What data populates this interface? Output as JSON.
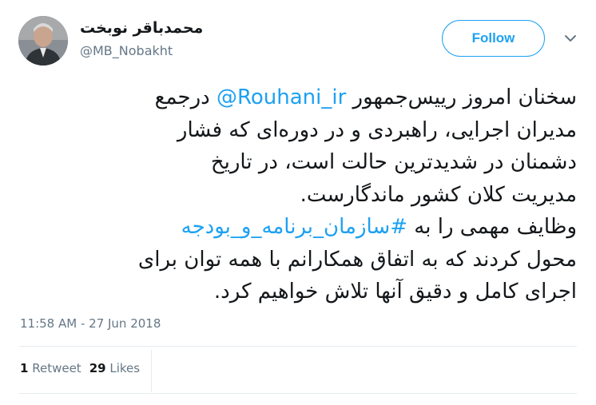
{
  "author": {
    "display_name": "محمدباقر نوبخت",
    "handle": "@MB_Nobakht"
  },
  "follow_label": "Follow",
  "tweet": {
    "line1_pre": "سخنان امروز رییس‌جمهور ",
    "mention": "@Rouhani_ir",
    "line1_post": " درجمع",
    "line2": "مدیران اجرایی، راهبردی و در دوره‌ای که فشار",
    "line3": "دشمنان در شدیدترین حالت است، در تاریخ",
    "line4": "مدیریت کلان کشور ماندگارست.",
    "line5_pre": "وظایف مهمی را به ",
    "hashtag": "#سازمان_برنامه_و_بودجه",
    "line6": "محول کردند که به اتفاق همکارانم با همه توان برای",
    "line7": "اجرای کامل و دقیق آنها تلاش خواهیم کرد."
  },
  "timestamp": "11:58 AM - 27 Jun 2018",
  "stats": {
    "retweets_count": "1",
    "retweets_label": "Retweet",
    "likes_count": "29",
    "likes_label": "Likes"
  },
  "colors": {
    "accent": "#1da1f2",
    "text": "#14171a",
    "secondary": "#657786",
    "divider": "#e6ecf0"
  },
  "icons": {
    "more": "chevron-down-icon"
  }
}
